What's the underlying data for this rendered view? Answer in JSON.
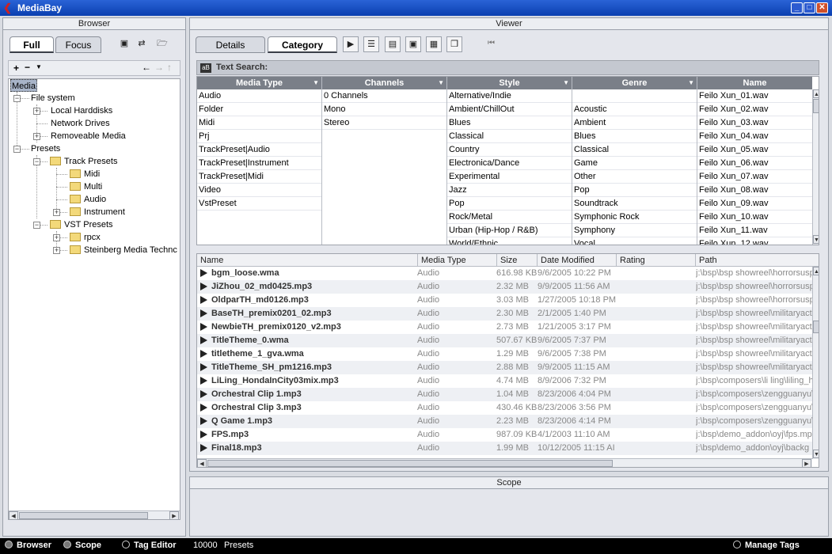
{
  "window": {
    "title": "MediaBay"
  },
  "browser": {
    "title": "Browser",
    "tabs": [
      "Full",
      "Focus"
    ],
    "tree": [
      {
        "label": "Media",
        "level": 0,
        "selected": true
      },
      {
        "label": "File system",
        "level": 1,
        "exp": "-"
      },
      {
        "label": "Local Harddisks",
        "level": 2,
        "exp": "+"
      },
      {
        "label": "Network Drives",
        "level": 2
      },
      {
        "label": "Removeable Media",
        "level": 2,
        "exp": "+"
      },
      {
        "label": "Presets",
        "level": 1,
        "exp": "-"
      },
      {
        "label": "Track Presets",
        "level": 2,
        "exp": "-",
        "folder": true
      },
      {
        "label": "Midi",
        "level": 3,
        "folder": true
      },
      {
        "label": "Multi",
        "level": 3,
        "folder": true
      },
      {
        "label": "Audio",
        "level": 3,
        "folder": true
      },
      {
        "label": "Instrument",
        "level": 3,
        "exp": "+",
        "folder": true
      },
      {
        "label": "VST Presets",
        "level": 2,
        "exp": "-",
        "folder": true
      },
      {
        "label": "rpcx",
        "level": 3,
        "exp": "+",
        "folder": true
      },
      {
        "label": "Steinberg Media Technc",
        "level": 3,
        "exp": "+",
        "folder": true
      }
    ]
  },
  "viewer": {
    "title": "Viewer",
    "tabs": [
      "Details",
      "Category"
    ],
    "text_search_label": "Text Search:",
    "filters": [
      {
        "header": "Media Type",
        "items": [
          "Audio",
          "Folder",
          "Midi",
          "Prj",
          "TrackPreset|Audio",
          "TrackPreset|Instrument",
          "TrackPreset|Midi",
          "Video",
          "VstPreset"
        ]
      },
      {
        "header": "Channels",
        "items": [
          "0 Channels",
          "Mono",
          "Stereo"
        ]
      },
      {
        "header": "Style",
        "items": [
          "Alternative/Indie",
          "Ambient/ChillOut",
          "Blues",
          "Classical",
          "Country",
          "Electronica/Dance",
          "Experimental",
          "Jazz",
          "Pop",
          "Rock/Metal",
          "Urban (Hip-Hop / R&B)",
          "World/Ethnic"
        ]
      },
      {
        "header": "Genre",
        "items": [
          "",
          "Acoustic",
          "Ambient",
          "Blues",
          "Classical",
          "Game",
          "Other",
          "Pop",
          "Soundtrack",
          "Symphonic Rock",
          "Symphony",
          "Vocal"
        ]
      },
      {
        "header": "Name",
        "items": [
          "Feilo Xun_01.wav",
          "Feilo Xun_02.wav",
          "Feilo Xun_03.wav",
          "Feilo Xun_04.wav",
          "Feilo Xun_05.wav",
          "Feilo Xun_06.wav",
          "Feilo Xun_07.wav",
          "Feilo Xun_08.wav",
          "Feilo Xun_09.wav",
          "Feilo Xun_10.wav",
          "Feilo Xun_11.wav",
          "Feilo Xun_12.wav"
        ]
      }
    ],
    "results": {
      "columns": [
        "Name",
        "Media Type",
        "Size",
        "Date Modified",
        "Rating",
        "Path"
      ],
      "rows": [
        {
          "name": "bgm_loose.wma",
          "type": "Audio",
          "size": "616.98 KB",
          "date": "9/6/2005 10:22 PM",
          "path": "j:\\bsp\\bsp showreel\\horrorsusp"
        },
        {
          "name": "JiZhou_02_md0425.mp3",
          "type": "Audio",
          "size": "2.32 MB",
          "date": "9/9/2005 11:56 AM",
          "path": "j:\\bsp\\bsp showreel\\horrorsusp"
        },
        {
          "name": "OldparTH_md0126.mp3",
          "type": "Audio",
          "size": "3.03 MB",
          "date": "1/27/2005 10:18 PM",
          "path": "j:\\bsp\\bsp showreel\\horrorsusp"
        },
        {
          "name": "BaseTH_premix0201_02.mp3",
          "type": "Audio",
          "size": "2.30 MB",
          "date": "2/1/2005 1:40 PM",
          "path": "j:\\bsp\\bsp showreel\\militaryacti"
        },
        {
          "name": "NewbieTH_premix0120_v2.mp3",
          "type": "Audio",
          "size": "2.73 MB",
          "date": "1/21/2005 3:17 PM",
          "path": "j:\\bsp\\bsp showreel\\militaryacti"
        },
        {
          "name": "TitleTheme_0.wma",
          "type": "Audio",
          "size": "507.67 KB",
          "date": "9/6/2005 7:37 PM",
          "path": "j:\\bsp\\bsp showreel\\militaryacti"
        },
        {
          "name": "titletheme_1_gva.wma",
          "type": "Audio",
          "size": "1.29 MB",
          "date": "9/6/2005 7:38 PM",
          "path": "j:\\bsp\\bsp showreel\\militaryacti"
        },
        {
          "name": "TitleTheme_SH_pm1216.mp3",
          "type": "Audio",
          "size": "2.88 MB",
          "date": "9/9/2005 11:15 AM",
          "path": "j:\\bsp\\bsp showreel\\militaryacti"
        },
        {
          "name": "LiLing_HondaInCity03mix.mp3",
          "type": "Audio",
          "size": "4.74 MB",
          "date": "8/9/2006 7:32 PM",
          "path": "j:\\bsp\\composers\\li ling\\liling_h"
        },
        {
          "name": "Orchestral Clip 1.mp3",
          "type": "Audio",
          "size": "1.04 MB",
          "date": "8/23/2006 4:04 PM",
          "path": "j:\\bsp\\composers\\zengguanyu\\"
        },
        {
          "name": "Orchestral Clip 3.mp3",
          "type": "Audio",
          "size": "430.46 KB",
          "date": "8/23/2006 3:56 PM",
          "path": "j:\\bsp\\composers\\zengguanyu\\"
        },
        {
          "name": "Q Game 1.mp3",
          "type": "Audio",
          "size": "2.23 MB",
          "date": "8/23/2006 4:14 PM",
          "path": "j:\\bsp\\composers\\zengguanyu\\"
        },
        {
          "name": "FPS.mp3",
          "type": "Audio",
          "size": "987.09 KB",
          "date": "4/1/2003 11:10 AM",
          "path": "j:\\bsp\\demo_addon\\oyj\\fps.mp"
        },
        {
          "name": "Final18.mp3",
          "type": "Audio",
          "size": "1.99 MB",
          "date": "10/12/2005 11:15 AI",
          "path": "j:\\bsp\\demo_addon\\oyj\\backg"
        }
      ]
    }
  },
  "scope": {
    "title": "Scope"
  },
  "status": {
    "browser": "Browser",
    "scope": "Scope",
    "tag_editor": "Tag Editor",
    "count": "10000",
    "presets": "Presets",
    "manage_tags": "Manage Tags"
  }
}
